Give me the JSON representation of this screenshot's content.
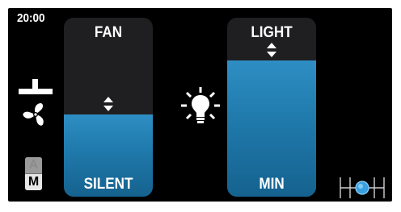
{
  "status_bar": {
    "time": "20:00"
  },
  "fan": {
    "title": "FAN",
    "value_label": "SILENT",
    "level": 0.46,
    "icon": "fan-control-icon"
  },
  "light": {
    "title": "LIGHT",
    "value_label": "MIN",
    "level": 0.76,
    "icon": "bulb-icon"
  },
  "mode": {
    "options": [
      "A",
      "M"
    ],
    "selected": "M"
  },
  "scene_switch": {
    "icon": "scene-switch-icon",
    "accent": "#3aa0e0"
  },
  "colors": {
    "background": "#000000",
    "slider_track": "#1f1f21",
    "slider_fill": "#1f79ab",
    "text": "#ffffff"
  }
}
